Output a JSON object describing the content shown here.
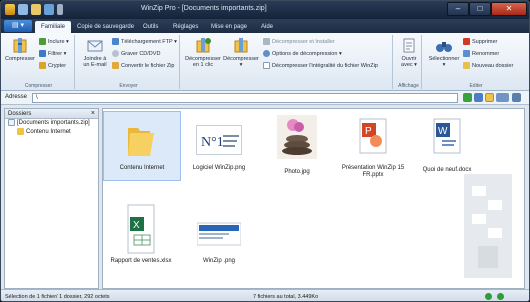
{
  "window": {
    "title": "WinZip Pro - [Documents importants.zip]"
  },
  "tabs": [
    {
      "label": "Familiale",
      "active": true
    },
    {
      "label": "Copie de sauvegarde"
    },
    {
      "label": "Outils"
    },
    {
      "label": "Réglages"
    },
    {
      "label": "Mise en page"
    },
    {
      "label": "Aide"
    }
  ],
  "ribbon": {
    "compresser": {
      "group_label": "Compresser",
      "big_label": "Compresser",
      "inclure": "Inclure",
      "filtrer": "Filtrer",
      "crypter": "Crypter"
    },
    "envoyer": {
      "group_label": "Envoyer",
      "email_label": "Joindre à un E-mail",
      "ftp": "Téléchargement FTP",
      "graver": "Graver CD/DVD",
      "convertir": "Convertir le fichier Zip"
    },
    "decompresser": {
      "en1clic": "Décompresser en 1 clic",
      "decomp": "Décompresser",
      "decomp_installer": "Décompresser et Installer",
      "options": "Options de décompression",
      "integralite": "Décompresser l'intégralité du fichier WinZip"
    },
    "affichage": {
      "group_label": "Affichage",
      "ouvrir": "Ouvrir avec"
    },
    "editer": {
      "group_label": "Editer",
      "selectionner": "Sélectionner",
      "supprimer": "Supprimer",
      "renommer": "Renommer",
      "nouveau_dossier": "Nouveau dossier"
    }
  },
  "address": {
    "label": "Adresse",
    "value": "\\"
  },
  "folders": {
    "title": "Dossiers",
    "items": [
      {
        "label": "[Documents importants.zip]"
      },
      {
        "label": "Contenu Internet"
      }
    ]
  },
  "files": [
    {
      "name": "Contenu Internet",
      "kind": "folder"
    },
    {
      "name": "Logiciel WinZip.png",
      "kind": "image"
    },
    {
      "name": "Photo.jpg",
      "kind": "photo"
    },
    {
      "name": "Présentation WinZip 15 FR.pptx",
      "kind": "pptx"
    },
    {
      "name": "Quoi de neuf.docx",
      "kind": "docx"
    },
    {
      "name": "Rapport de ventes.xlsx",
      "kind": "xlsx"
    },
    {
      "name": "WinZip .png",
      "kind": "image2"
    }
  ],
  "status": {
    "left": "Sélection de 1 fichier/ 1 dossier, 292 octets",
    "mid": "7 fichiers au total, 3.449Ko"
  },
  "colors": {
    "accent": "#1d5cb0",
    "titlebar": "#1b2a42"
  }
}
